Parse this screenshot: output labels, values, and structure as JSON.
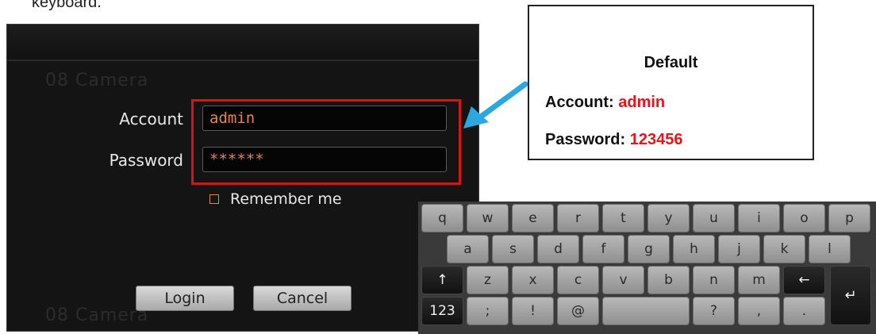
{
  "caption": "keyboard.",
  "dialog": {
    "ghost_top": "08 Camera",
    "ghost_bottom": "08 Camera",
    "account_label": "Account",
    "account_value": "admin",
    "password_label": "Password",
    "password_value": "******",
    "remember_label": "Remember me",
    "remember_checked": false,
    "login_label": "Login",
    "cancel_label": "Cancel"
  },
  "callout": {
    "title": "Default",
    "account_label": "Account:",
    "account_value": "admin",
    "password_label": "Password:",
    "password_value": "123456",
    "value_color": "#e8141a",
    "arrow_color": "#2aa8e0"
  },
  "keyboard": {
    "row1": [
      "q",
      "w",
      "e",
      "r",
      "t",
      "y",
      "u",
      "i",
      "o",
      "p"
    ],
    "row2": [
      "a",
      "s",
      "d",
      "f",
      "g",
      "h",
      "j",
      "k",
      "l"
    ],
    "row3": [
      "↑",
      "z",
      "x",
      "c",
      "v",
      "b",
      "n",
      "m",
      "←"
    ],
    "row4": [
      "123",
      ";",
      "!",
      "@",
      "",
      "?",
      ",",
      "."
    ],
    "enter": "↵",
    "shift_icon": "shift-icon",
    "backspace_icon": "backspace-icon",
    "enter_icon": "enter-icon"
  }
}
